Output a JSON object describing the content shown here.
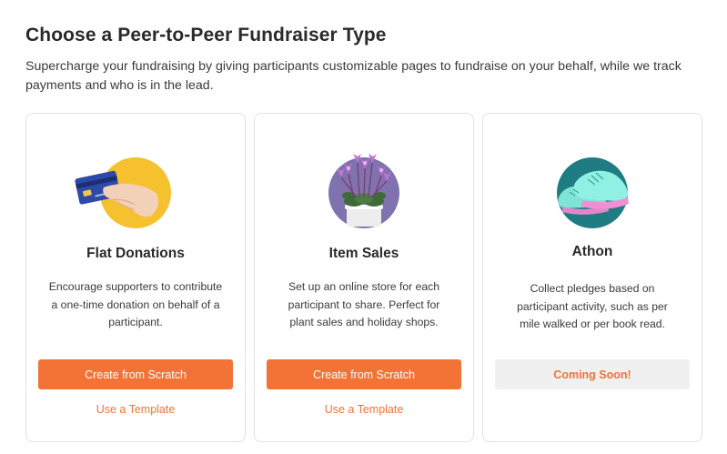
{
  "header": {
    "title": "Choose a Peer-to-Peer Fundraiser Type",
    "description": "Supercharge your fundraising by giving participants customizable pages to fundraise on your behalf, while we track payments and who is in the lead."
  },
  "cards": [
    {
      "title": "Flat Donations",
      "description": "Encourage supporters to contribute a one-time donation on behalf of a participant.",
      "primary_label": "Create from Scratch",
      "secondary_label": "Use a Template",
      "icon": "credit-card-hand-icon"
    },
    {
      "title": "Item Sales",
      "description": "Set up an online store for each participant to share. Perfect for plant sales and holiday shops.",
      "primary_label": "Create from Scratch",
      "secondary_label": "Use a Template",
      "icon": "potted-plant-icon"
    },
    {
      "title": "Athon",
      "description": "Collect pledges based on participant activity, such as per mile walked or per book read.",
      "status_label": "Coming Soon!",
      "icon": "sneakers-icon"
    }
  ],
  "colors": {
    "accent": "#f37336",
    "card_border": "#e2e2e2",
    "disabled_bg": "#f0f0f0",
    "flat_donations_circle": "#f6c12f",
    "item_sales_circle": "#7f72ae",
    "athon_circle": "#1f7c83"
  }
}
